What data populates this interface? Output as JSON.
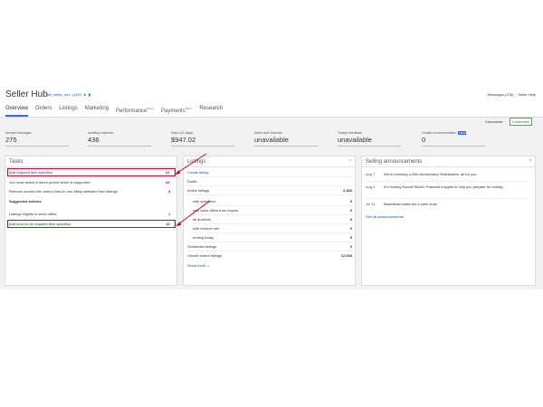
{
  "header": {
    "title": "Seller Hub",
    "user_name": "bill_seller_us1",
    "feedback": "(1310",
    "star_icon": "star-icon",
    "messages": "Messages (276)",
    "seller_help": "Seller Help"
  },
  "tabs": [
    {
      "label": "Overview",
      "active": true
    },
    {
      "label": "Orders"
    },
    {
      "label": "Listings"
    },
    {
      "label": "Marketing"
    },
    {
      "label": "Performance",
      "sup": "BETA"
    },
    {
      "label": "Payments",
      "sup": "BETA"
    },
    {
      "label": "Research"
    }
  ],
  "toolbar": {
    "comments": "Comments",
    "customize": "Customize"
  },
  "metrics": [
    {
      "label": "Unread messages",
      "value": "275"
    },
    {
      "label": "Awaiting shipment",
      "value": "436"
    },
    {
      "label": "Sales (31 days)",
      "value": "$947.02"
    },
    {
      "label": "Seller level forecast",
      "value": "unavailable"
    },
    {
      "label": "Today's feedback",
      "value": "unavailable"
    },
    {
      "label": "Growth recommendation",
      "value": "0",
      "badge": "NEW"
    }
  ],
  "tasks": {
    "title": "Tasks",
    "items": [
      {
        "label": "Add required item specifics",
        "count": "22"
      },
      {
        "label": "You must select a return period which is supported",
        "count": "44"
      },
      {
        "label": "Remove contact info and/or links to non-eBay websites from listings",
        "count": "3"
      }
    ],
    "suggested_title": "Suggested actions",
    "suggested": [
      {
        "label": "Listings eligible to send offers",
        "count": "1"
      },
      {
        "label": "Add soon to be required item specifics",
        "count": "18"
      }
    ]
  },
  "listings": {
    "title": "Listings",
    "rows": [
      {
        "label": "Create listing",
        "count": "",
        "link": true
      },
      {
        "label": "Drafts",
        "count": ""
      },
      {
        "label": "Active listings",
        "count": "4,383"
      },
      {
        "label": "with questions",
        "count": "0",
        "indent": true
      },
      {
        "label": "with open offers from buyers",
        "count": "0",
        "indent": true
      },
      {
        "label": "all auctions",
        "count": "0",
        "indent": true
      },
      {
        "label": "with reserve met",
        "count": "0",
        "indent": true
      },
      {
        "label": "ending today",
        "count": "5",
        "indent": true
      },
      {
        "label": "Scheduled listings",
        "count": "0"
      },
      {
        "label": "Unsold ended listings",
        "count": "12,008"
      }
    ],
    "show_more": "Show more"
  },
  "announcements": {
    "title": "Selling announcements",
    "items": [
      {
        "date": "Aug 7",
        "text": "We're throwing a 25th Anniversary Sellebration, all for you"
      },
      {
        "date": "Aug 4",
        "text": "It's Holiday Kickoff Month: Practical insights to help you prepare for holiday"
      },
      {
        "date": "Jul 31",
        "text": "Basketball cards are a slam dunk"
      }
    ],
    "see_all": "See all announcements"
  },
  "colors": {
    "accent": "#3665f3",
    "alert": "#d0021b",
    "link": "#0654ba"
  }
}
